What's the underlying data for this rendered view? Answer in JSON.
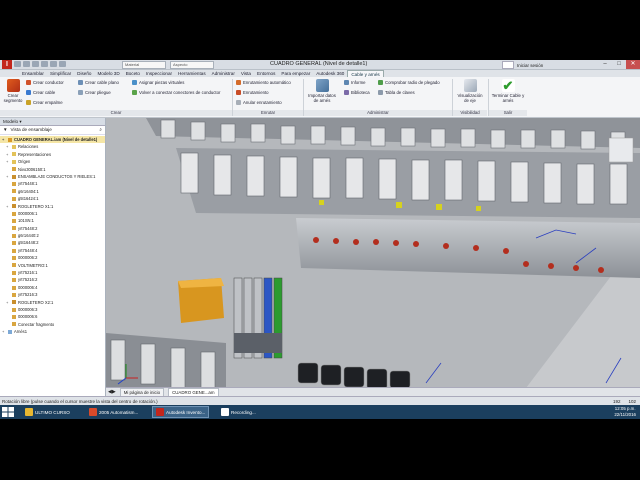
{
  "window": {
    "title": "CUADRO GENERAL (Nivel de detalle1)",
    "user": "Iniciar sesión",
    "material_combo": "Material",
    "appearance_combo": "Aspecto"
  },
  "tabs": [
    "Ensamblar",
    "Simplificar",
    "Diseño",
    "Modelo 3D",
    "Boceto",
    "Inspeccionar",
    "Herramientas",
    "Administrar",
    "Vista",
    "Entornos",
    "Para empezar",
    "Autodesk 360",
    "Cable y arnés"
  ],
  "active_tab_index": 12,
  "ribbon": {
    "crear_segmento": "Crear segmento",
    "crear_conductor": "Crear conductor",
    "crear_cable": "Crear cable",
    "crear_empalme": "Crear empalme",
    "crear_cable_plano": "Crear cable plano",
    "crear_pliegue": "Crear pliegue",
    "asignar_piezas": "Asignar piezas virtuales",
    "conectar": "Volver a conectar conectores de conductor",
    "enrutamiento_auto": "Enrutamiento automático",
    "enrutamiento": "Enrutamiento",
    "anular_enrutamiento": "Anular enrutamiento",
    "importar": "Importar datos de arnés",
    "informe": "Informe",
    "biblioteca": "Biblioteca",
    "comprobar": "Comprobar radio de plegado",
    "tabla_claves": "Tabla de claves",
    "visualizacion": "Visualización de eje",
    "terminar": "Terminar Cable y arnés",
    "panels": {
      "crear": "Crear",
      "enrutar": "Enrutar",
      "administrar": "Administrar",
      "visibilidad": "Visibilidad",
      "salir": "Salir"
    }
  },
  "browser": {
    "header": "Modelo",
    "toolbar": "Vista de ensamblaje",
    "nodes": [
      {
        "label": "CUADRO GENERAL.iam (Nivel de detalle1)",
        "type": "root"
      },
      {
        "label": "Relaciones",
        "type": "folder"
      },
      {
        "label": "Representaciones",
        "type": "folder"
      },
      {
        "label": "Origen",
        "type": "folder"
      },
      {
        "label": "Nivo3006150:1",
        "type": "part"
      },
      {
        "label": "ENSAMBLAJE CONDUCTOS Y RIELES:1",
        "type": "asm"
      },
      {
        "label": "yrt75448:1",
        "type": "part"
      },
      {
        "label": "g6r16404:1",
        "type": "part"
      },
      {
        "label": "g5t16424:1",
        "type": "part"
      },
      {
        "label": "ROGLETERO X1:1",
        "type": "asm"
      },
      {
        "label": "0000006:1",
        "type": "part"
      },
      {
        "label": "101SN:1",
        "type": "part"
      },
      {
        "label": "yrt75448:2",
        "type": "part"
      },
      {
        "label": "g6r16440:2",
        "type": "part"
      },
      {
        "label": "g5t16448:2",
        "type": "part"
      },
      {
        "label": "yrt75448:4",
        "type": "part"
      },
      {
        "label": "0000006:2",
        "type": "part"
      },
      {
        "label": "VOLTIMETRO:1",
        "type": "part"
      },
      {
        "label": "yrt75216:1",
        "type": "part"
      },
      {
        "label": "yrt75216:2",
        "type": "part"
      },
      {
        "label": "0000006:4",
        "type": "part"
      },
      {
        "label": "yrt75216:3",
        "type": "part"
      },
      {
        "label": "ROGLETERO X2:1",
        "type": "asm"
      },
      {
        "label": "0000006:3",
        "type": "part"
      },
      {
        "label": "0000006:6",
        "type": "part"
      },
      {
        "label": "Conectar fragmento",
        "type": "part"
      },
      {
        "label": "Arnés1",
        "type": "harness"
      }
    ]
  },
  "view_tabs": [
    "Mi página de inicio",
    "CUADRO GENE...am"
  ],
  "status": {
    "text": "Rotación libre (pulse cuando el cursor muestre la vista del centro de rotación.)",
    "n1": "192",
    "n2": "102"
  },
  "taskbar": {
    "items": [
      "ULTIMO CURSO",
      "2005 Automatism...",
      "Autodesk Invento...",
      "Recording..."
    ],
    "time": "12:05 p.m.",
    "date": "22/11/2016"
  }
}
